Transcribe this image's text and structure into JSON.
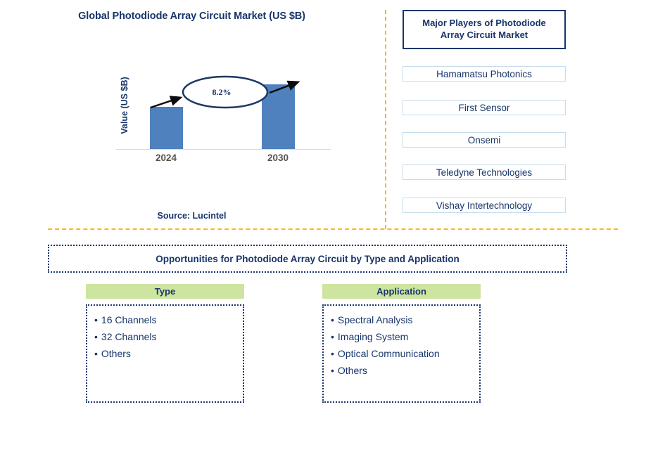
{
  "chart": {
    "title": "Global Photodiode Array Circuit Market (US $B)",
    "y_axis_label": "Value (US $B)",
    "source": "Source: Lucintel"
  },
  "chart_data": {
    "type": "bar",
    "title": "Global Photodiode Array Circuit Market (US $B)",
    "categories": [
      "2024",
      "2030"
    ],
    "values": [
      60,
      92
    ],
    "xlabel": "",
    "ylabel": "Value (US $B)",
    "annotation": "8.2%",
    "annotation_meaning": "CAGR from 2024 to 2030",
    "grid": false,
    "legend": "none",
    "bar_color": "#4E81BD",
    "tick_labels": [
      "2024",
      "2030"
    ],
    "source": "Source: Lucintel"
  },
  "players": {
    "header": "Major Players of Photodiode Array Circuit Market",
    "header_line1": "Major Players of Photodiode",
    "header_line2": "Array Circuit Market",
    "items": [
      {
        "label": "Hamamatsu Photonics"
      },
      {
        "label": "First Sensor"
      },
      {
        "label": "Onsemi"
      },
      {
        "label": "Teledyne Technologies"
      },
      {
        "label": "Vishay Intertechnology"
      }
    ]
  },
  "opportunities": {
    "title": "Opportunities for Photodiode Array Circuit by Type and Application",
    "columns": [
      {
        "header": "Type",
        "items": [
          "16 Channels",
          "32 Channels",
          "Others"
        ]
      },
      {
        "header": "Application",
        "items": [
          "Spectral Analysis",
          "Imaging System",
          "Optical Communication",
          "Others"
        ]
      }
    ]
  },
  "colors": {
    "navy": "#17356B",
    "bar_blue": "#4E81BD",
    "divider_yellow": "#FBBA12",
    "header_green": "#CDE5A0",
    "player_border": "#C5DCEC",
    "year_label": "#58534A"
  },
  "bullet": "•"
}
